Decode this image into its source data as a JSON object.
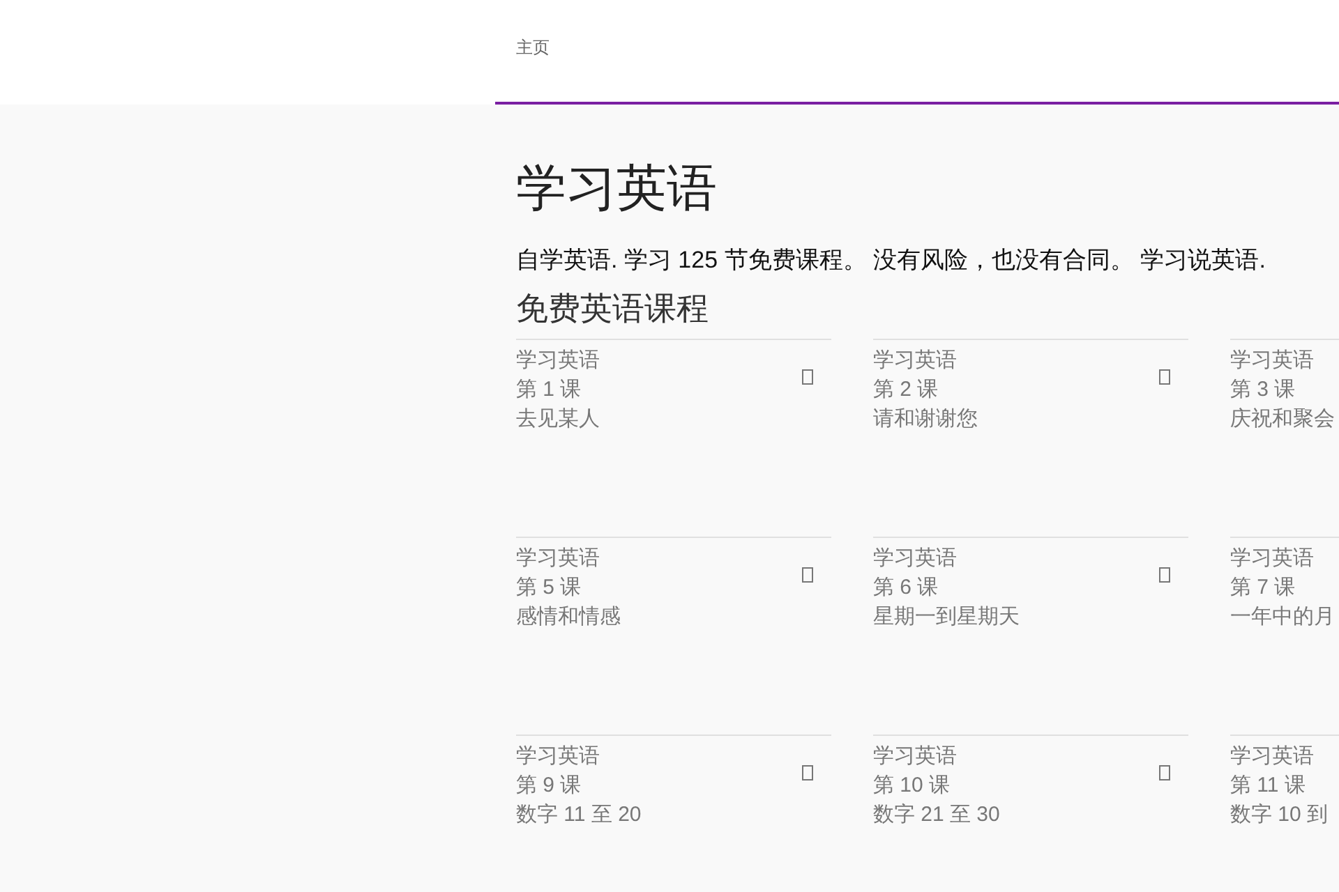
{
  "nav": {
    "label": "主页"
  },
  "title": "学习英语",
  "intro": "自学英语. 学习 125 节免费课程。 没有风险，也没有合同。 学习说英语.",
  "section_title": "免费英语课程",
  "lessons": [
    {
      "course": "学习英语",
      "number": "第 1 课",
      "topic": "去见某人",
      "icon": true
    },
    {
      "course": "学习英语",
      "number": "第 2 课",
      "topic": "请和谢谢您",
      "icon": true
    },
    {
      "course": "学习英语",
      "number": "第 3 课",
      "topic": "庆祝和聚会",
      "icon": false
    },
    {
      "course": "学习英语",
      "number": "第 5 课",
      "topic": "感情和情感",
      "icon": true
    },
    {
      "course": "学习英语",
      "number": "第 6 课",
      "topic": "星期一到星期天",
      "icon": true
    },
    {
      "course": "学习英语",
      "number": "第 7 课",
      "topic": "一年中的月",
      "icon": false
    },
    {
      "course": "学习英语",
      "number": "第 9 课",
      "topic": "数字 11 至 20",
      "icon": true
    },
    {
      "course": "学习英语",
      "number": "第 10 课",
      "topic": "数字 21 至 30",
      "icon": true
    },
    {
      "course": "学习英语",
      "number": "第 11 课",
      "topic": "数字 10 到",
      "icon": false
    }
  ]
}
